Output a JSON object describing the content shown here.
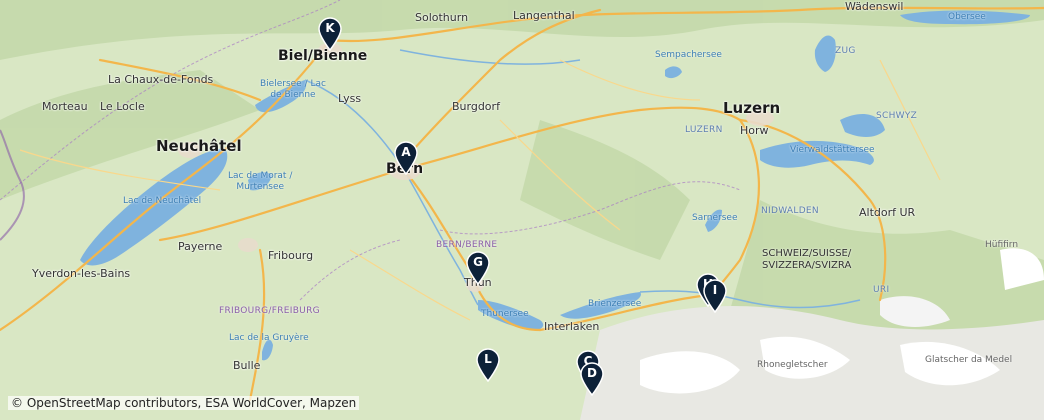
{
  "map": {
    "attribution": "© OpenStreetMap contributors, ESA WorldCover, Mapzen",
    "colors": {
      "land": "#d9e7c4",
      "water": "#7fb3de",
      "road": "#f3b64b",
      "glacier": "#ffffff"
    },
    "places": {
      "wadenswil": "Wädenswil",
      "solothurn": "Solothurn",
      "langenthal": "Langenthal",
      "biel": "Biel/Bienne",
      "laChauxDeFonds": "La Chaux-de-Fonds",
      "morteau": "Morteau",
      "leLocle": "Le Locle",
      "lyss": "Lyss",
      "burgdorf": "Burgdorf",
      "neuchatel": "Neuchâtel",
      "bern": "Bern",
      "luzern": "Luzern",
      "horw": "Horw",
      "zug": "ZUG",
      "schwyz": "SCHWYZ",
      "luzernRegion": "LUZERN",
      "nidwalden": "NIDWALDEN",
      "altdorf": "Altdorf UR",
      "bernRegion": "BERN/BERNE",
      "payerne": "Payerne",
      "yverdon": "Yverdon-les-Bains",
      "fribourg": "Fribourg",
      "fribourgRegion": "FRIBOURG/FREIBURG",
      "thun": "Thun",
      "interlaken": "Interlaken",
      "bulle": "Bulle",
      "country": "SCHWEIZ/SUISSE/\nSVIZZERA/SVIZRA",
      "uri": "URI",
      "hoefirn": "Hüfifirn",
      "glatscher": "Glatscher da Medel",
      "rhonegletscher": "Rhonegletscher"
    },
    "waters": {
      "obersee": "Obersee",
      "sempachersee": "Sempachersee",
      "bielersee": "Bielersee / Lac\nde Bienne",
      "vierwaldstattersee": "Vierwaldstättersee",
      "sarnersee": "Sarnersee",
      "lacDeMorat": "Lac de Morat /\nMurtensee",
      "lacDeNeuchatel": "Lac de Neuchâtel",
      "brienzersee": "Brienzersee",
      "thunersee": "Thunersee",
      "lacDeLaGruyere": "Lac de la Gruyère"
    },
    "markers": [
      "K",
      "A",
      "G",
      "L",
      "C",
      "D",
      "H",
      "I"
    ]
  }
}
